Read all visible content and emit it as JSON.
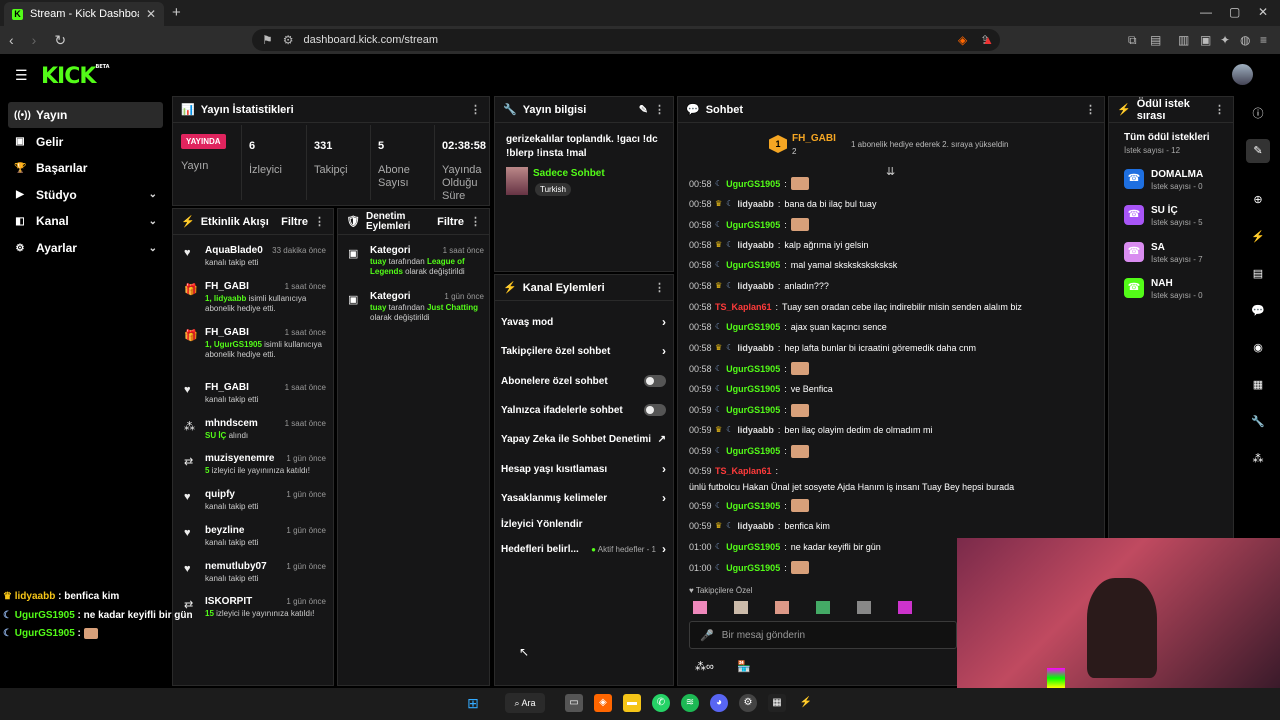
{
  "browser": {
    "tab_title": "Stream - Kick Dashboard",
    "url": "dashboard.kick.com/stream"
  },
  "logo": {
    "text": "KICK",
    "badge": "BETA"
  },
  "sidebar": {
    "items": [
      {
        "label": "Yayın",
        "icon": "broadcast-icon",
        "active": true
      },
      {
        "label": "Gelir",
        "icon": "wallet-icon"
      },
      {
        "label": "Başarılar",
        "icon": "trophy-icon"
      },
      {
        "label": "Stüdyo",
        "icon": "studio-icon",
        "chevron": "⌄"
      },
      {
        "label": "Kanal",
        "icon": "channel-icon",
        "chevron": "⌄"
      },
      {
        "label": "Ayarlar",
        "icon": "gear-icon",
        "chevron": "⌄"
      }
    ]
  },
  "stats": {
    "title": "Yayın İstatistikleri",
    "live_badge": "YAYINDA",
    "live_label": "Yayın",
    "items": [
      {
        "value": "6",
        "label": "İzleyici"
      },
      {
        "value": "331",
        "label": "Takipçi"
      },
      {
        "value": "5",
        "label": "Abone Sayısı"
      },
      {
        "value": "02:38:58",
        "label": "Yayında Olduğu Süre"
      }
    ]
  },
  "stream_info": {
    "title": "Yayın bilgisi",
    "stream_title": "gerizekalılar toplandık. !gacı !dc !blerp !insta !mal",
    "category": "Sadece Sohbet",
    "tag": "Turkish"
  },
  "activity": {
    "title": "Etkinlik Akışı",
    "filter": "Filtre",
    "items": [
      {
        "icon": "♥",
        "name": "AquaBlade0",
        "time": "33 dakika önce",
        "desc": "kanalı takip etti"
      },
      {
        "icon": "🎁",
        "name": "FH_GABI",
        "time": "1 saat önce",
        "desc_hl": "1, lidyaabb",
        "desc": " isimli kullanıcıya abonelik hediye etti."
      },
      {
        "icon": "🎁",
        "name": "FH_GABI",
        "time": "1 saat önce",
        "desc_hl": "1, UgurGS1905",
        "desc": " isimli kullanıcıya abonelik hediye etti."
      },
      {
        "icon": "♥",
        "name": "FH_GABI",
        "time": "1 saat önce",
        "desc": "kanalı takip etti"
      },
      {
        "icon": "⁂",
        "name": "mhndscem",
        "time": "1 saat önce",
        "desc_hl": "SU İÇ",
        "desc": " alındı"
      },
      {
        "icon": "⇄",
        "name": "muzisyenemre",
        "time": "1 gün önce",
        "desc_hl": "5",
        "desc": " izleyici ile yayınınıza katıldı!"
      },
      {
        "icon": "♥",
        "name": "quipfy",
        "time": "1 gün önce",
        "desc": "kanalı takip etti"
      },
      {
        "icon": "♥",
        "name": "beyzline",
        "time": "1 gün önce",
        "desc": "kanalı takip etti"
      },
      {
        "icon": "♥",
        "name": "nemutluby07",
        "time": "1 gün önce",
        "desc": "kanalı takip etti"
      },
      {
        "icon": "⇄",
        "name": "ISKORPIT",
        "time": "1 gün önce",
        "desc_hl": "15",
        "desc": " izleyici ile yayınınıza katıldı!"
      }
    ]
  },
  "moderation": {
    "title": "Denetim Eylemleri",
    "filter": "Filtre",
    "items": [
      {
        "name": "Kategori",
        "time": "1 saat önce",
        "user": "tuay",
        "mid": " tarafından ",
        "target": "League of Legends",
        "end": " olarak değiştirildi"
      },
      {
        "name": "Kategori",
        "time": "1 gün önce",
        "user": "tuay",
        "mid": " tarafından ",
        "target": "Just Chatting",
        "end": " olarak değiştirildi"
      }
    ]
  },
  "channel_actions": {
    "title": "Kanal Eylemleri",
    "items": [
      {
        "label": "Yavaş mod",
        "type": "chevron"
      },
      {
        "label": "Takipçilere özel sohbet",
        "type": "chevron"
      },
      {
        "label": "Abonelere özel sohbet",
        "type": "toggle"
      },
      {
        "label": "Yalnızca ifadelerle sohbet",
        "type": "toggle"
      },
      {
        "label": "Yapay Zeka ile Sohbet Denetimi",
        "type": "external"
      },
      {
        "label": "Hesap yaşı kısıtlaması",
        "type": "chevron"
      },
      {
        "label": "Yasaklanmış kelimeler",
        "type": "chevron"
      },
      {
        "label": "İzleyici Yönlendir",
        "type": "none"
      },
      {
        "label": "Hedefleri belirl...",
        "type": "chevron",
        "extra": "Aktif hedefler - 1"
      }
    ]
  },
  "chat": {
    "title": "Sohbet",
    "pinned_rank": "1",
    "pinned_user": "FH_GABI",
    "pinned_count": "2",
    "pinned_text": "1 abonelik hediye ederek 2. sıraya yükseldin",
    "messages": [
      {
        "t": "00:58",
        "crown": false,
        "u": "UgurGS1905",
        "c": "#53fc18",
        "m": "",
        "emote": true
      },
      {
        "t": "00:58",
        "crown": true,
        "u": "lidyaabb",
        "c": "#ddd",
        "m": "bana da bi ilaç bul tuay"
      },
      {
        "t": "00:58",
        "crown": false,
        "u": "UgurGS1905",
        "c": "#53fc18",
        "m": "",
        "emote": true
      },
      {
        "t": "00:58",
        "crown": true,
        "u": "lidyaabb",
        "c": "#ddd",
        "m": "kalp ağrıma iyi gelsin"
      },
      {
        "t": "00:58",
        "crown": false,
        "u": "UgurGS1905",
        "c": "#53fc18",
        "m": "mal yamal sksksksksksksk"
      },
      {
        "t": "00:58",
        "crown": true,
        "u": "lidyaabb",
        "c": "#ddd",
        "m": "anladın???"
      },
      {
        "t": "00:58",
        "crown": false,
        "u": "TS_Kaplan61",
        "c": "#ff3b3b",
        "m": "Tuay sen oradan cebe ilaç indirebilir misin senden alalım biz",
        "plain": true
      },
      {
        "t": "00:58",
        "crown": false,
        "u": "UgurGS1905",
        "c": "#53fc18",
        "m": "ajax şuan kaçıncı sence"
      },
      {
        "t": "00:58",
        "crown": true,
        "u": "lidyaabb",
        "c": "#ddd",
        "m": "hep lafta bunlar bi icraatini göremedik daha cnm"
      },
      {
        "t": "00:58",
        "crown": false,
        "u": "UgurGS1905",
        "c": "#53fc18",
        "m": "",
        "emote": true
      },
      {
        "t": "00:59",
        "crown": false,
        "u": "UgurGS1905",
        "c": "#53fc18",
        "m": "ve Benfica"
      },
      {
        "t": "00:59",
        "crown": false,
        "u": "UgurGS1905",
        "c": "#53fc18",
        "m": "",
        "emote": true
      },
      {
        "t": "00:59",
        "crown": true,
        "u": "lidyaabb",
        "c": "#ddd",
        "m": "ben ilaç olayim dedim de olmadım mi"
      },
      {
        "t": "00:59",
        "crown": false,
        "u": "UgurGS1905",
        "c": "#53fc18",
        "m": "",
        "emote": true
      },
      {
        "t": "00:59",
        "crown": false,
        "u": "TS_Kaplan61",
        "c": "#ff3b3b",
        "m": "ünlü futbolcu Hakan Ünal jet sosyete Ajda Hanım iş insanı Tuay Bey hepsi burada",
        "plain": true,
        "wrap": true
      },
      {
        "t": "00:59",
        "crown": false,
        "u": "UgurGS1905",
        "c": "#53fc18",
        "m": "",
        "emote": true
      },
      {
        "t": "00:59",
        "crown": true,
        "u": "lidyaabb",
        "c": "#ddd",
        "m": "benfica kim"
      },
      {
        "t": "01:00",
        "crown": false,
        "u": "UgurGS1905",
        "c": "#53fc18",
        "m": "ne kadar keyifli bir gün"
      },
      {
        "t": "01:00",
        "crown": false,
        "u": "UgurGS1905",
        "c": "#53fc18",
        "m": "",
        "emote": true
      }
    ],
    "followers_only": "Takipçilere Özel",
    "placeholder": "Bir mesaj gönderin"
  },
  "rewards": {
    "title": "Ödül istek sırası",
    "all": "Tüm ödül istekleri",
    "all_count": "İstek sayısı - 12",
    "items": [
      {
        "name": "DOMALMA",
        "count": "İstek sayısı - 0",
        "color": "#1e6fe0"
      },
      {
        "name": "SU İÇ",
        "count": "İstek sayısı - 5",
        "color": "#a855f7"
      },
      {
        "name": "SA",
        "count": "İstek sayısı - 7",
        "color": "#d98cf0"
      },
      {
        "name": "NAH",
        "count": "İstek sayısı - 0",
        "color": "#53fc18"
      }
    ]
  },
  "overlay_chat": [
    {
      "u": "lidyaabb",
      "c": "#f5c518",
      "m": " : benfica kim"
    },
    {
      "u": "UgurGS1905",
      "c": "#53fc18",
      "m": " : ne kadar keyifli bir gün"
    },
    {
      "u": "UgurGS1905",
      "c": "#53fc18",
      "m": " : "
    }
  ],
  "taskbar": {
    "search": "Ara"
  }
}
